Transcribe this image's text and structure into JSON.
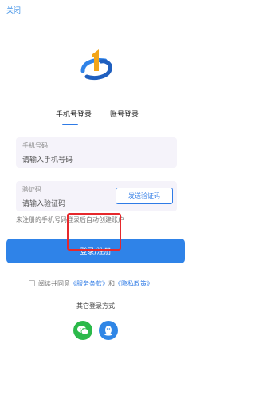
{
  "header": {
    "close_label": "关闭"
  },
  "tabs": [
    {
      "label": "手机号登录"
    },
    {
      "label": "账号登录"
    }
  ],
  "form": {
    "phone_label": "手机号码",
    "phone_placeholder": "请输入手机号码",
    "code_label": "验证码",
    "code_placeholder": "请输入验证码",
    "send_code_label": "发送验证码",
    "hint": "未注册的手机号码登录后自动创建账户",
    "submit_label": "登录/注册"
  },
  "agreement": {
    "prefix": "阅读并同意",
    "terms": "《服务条款》",
    "and": "和",
    "privacy": "《隐私政策》"
  },
  "other_login": {
    "title": "其它登录方式"
  },
  "icons": [
    "logo-icon",
    "checkbox-icon",
    "wechat-icon",
    "qq-icon"
  ],
  "colors": {
    "accent": "#2f83e8",
    "highlight_box": "#e6282c",
    "wechat": "#2bb94a",
    "qq": "#2f86e6"
  }
}
